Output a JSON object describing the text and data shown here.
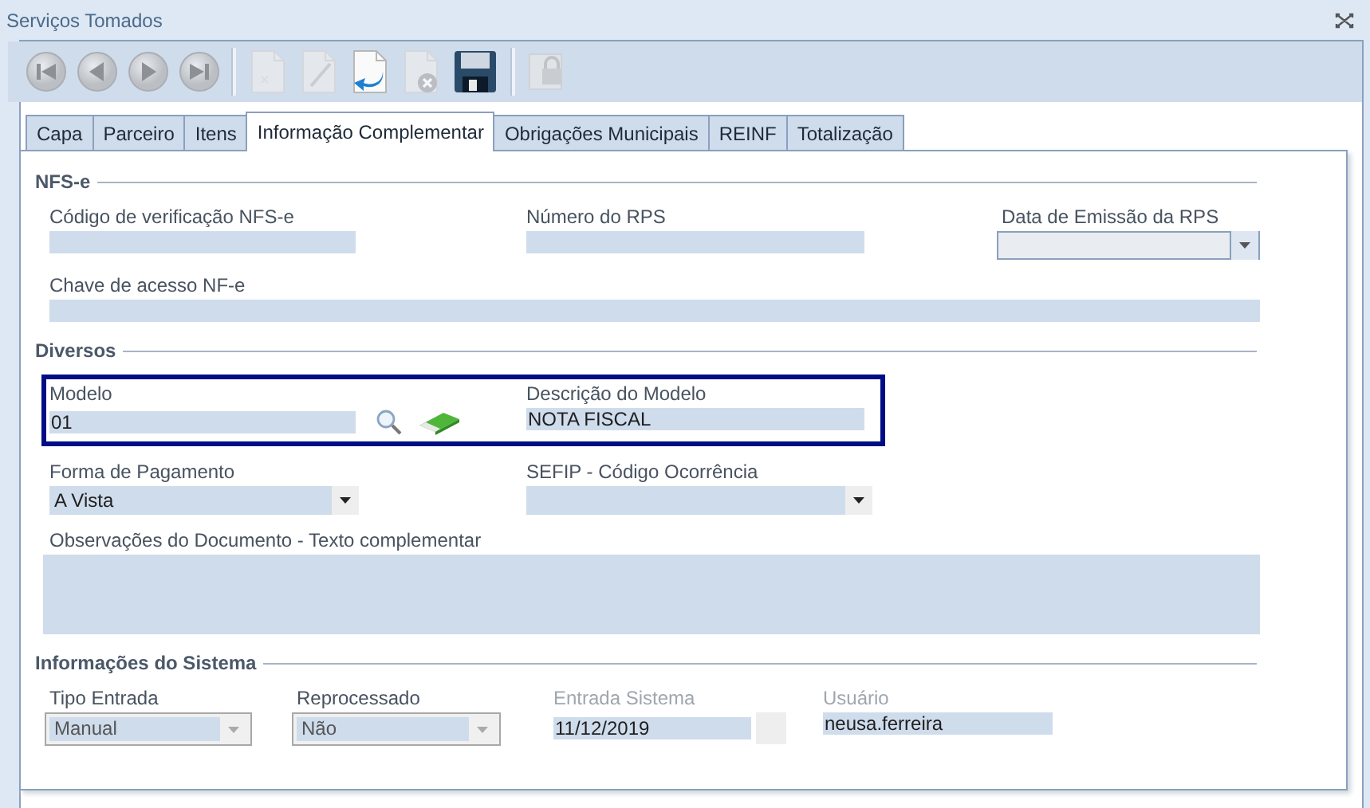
{
  "window": {
    "title": "Serviços Tomados"
  },
  "toolbar": [
    [
      {
        "kind": "first",
        "disabled": true
      },
      {
        "kind": "previous",
        "disabled": true
      },
      {
        "kind": "next",
        "disabled": true
      },
      {
        "kind": "last",
        "disabled": true
      }
    ],
    [
      {
        "kind": "new",
        "disabled": true
      },
      {
        "kind": "edit",
        "disabled": true
      },
      {
        "kind": "undo",
        "disabled": false
      },
      {
        "kind": "delete",
        "disabled": true
      },
      {
        "kind": "save",
        "disabled": false
      }
    ],
    [
      {
        "kind": "lock",
        "disabled": true
      }
    ]
  ],
  "tabs": [
    {
      "label": "Capa",
      "selected": false
    },
    {
      "label": "Parceiro",
      "selected": false
    },
    {
      "label": "Itens",
      "selected": false
    },
    {
      "label": "Informação Complementar",
      "selected": true
    },
    {
      "label": "Obrigações Municipais",
      "selected": false
    },
    {
      "label": "REINF",
      "selected": false
    },
    {
      "label": "Totalização",
      "selected": false
    }
  ],
  "sections": [
    {
      "title": "NFS-e",
      "rows": [
        {
          "highlighted": false,
          "fields": [
            {
              "kind": "text",
              "label": "Código de verificação NFS-e",
              "disabled": false
            },
            {
              "kind": "text",
              "label": "Número do RPS",
              "disabled": false
            },
            {
              "kind": "date",
              "label": "Data de Emissão da RPS",
              "disabled": false
            }
          ]
        },
        {
          "highlighted": false,
          "fields": [
            {
              "kind": "text",
              "label": "Chave de acesso NF-e",
              "disabled": false
            }
          ]
        }
      ]
    },
    {
      "title": "Diversos",
      "rows": [
        {
          "highlighted": true,
          "fields": [
            {
              "kind": "lookup",
              "label": "Modelo",
              "value": "01",
              "disabled": false
            },
            {
              "kind": "text",
              "label": "Descrição do Modelo",
              "value": "NOTA FISCAL",
              "disabled": false
            }
          ]
        },
        {
          "highlighted": false,
          "fields": [
            {
              "kind": "combo",
              "label": "Forma de Pagamento",
              "value": "A Vista",
              "disabled": false
            },
            {
              "kind": "combo",
              "label": "SEFIP - Código Ocorrência",
              "disabled": false
            }
          ]
        },
        {
          "highlighted": false,
          "fields": [
            {
              "kind": "textarea",
              "label": "Observações do Documento - Texto complementar",
              "disabled": false
            }
          ]
        }
      ]
    },
    {
      "title": "Informações do Sistema",
      "rows": [
        {
          "highlighted": false,
          "fields": [
            {
              "kind": "combo",
              "label": "Tipo Entrada",
              "value": "Manual",
              "disabled": true
            },
            {
              "kind": "combo",
              "label": "Reprocessado",
              "value": "Não",
              "disabled": true
            },
            {
              "kind": "datefield",
              "label": "Entrada Sistema",
              "value": "11/12/2019",
              "disabled": true
            },
            {
              "kind": "text",
              "label": "Usuário",
              "value": "neusa.ferreira",
              "disabled": true
            }
          ]
        }
      ]
    }
  ]
}
